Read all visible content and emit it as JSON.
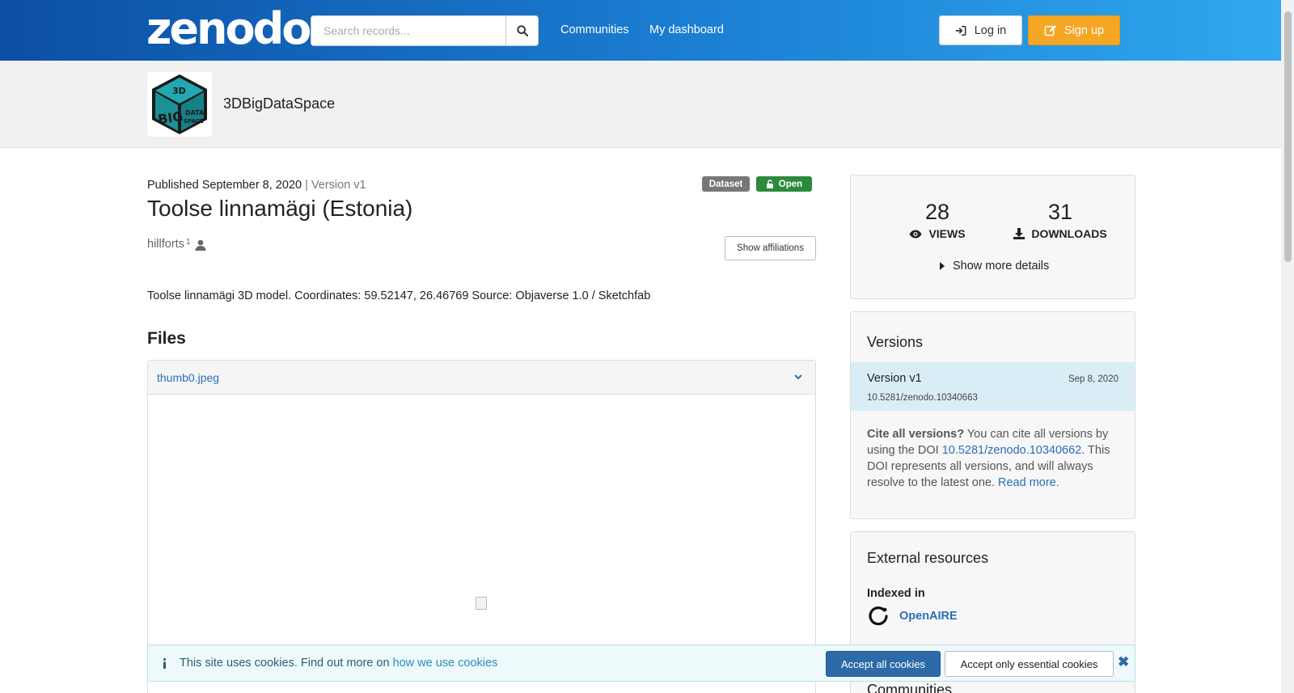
{
  "header": {
    "logo_text": "zenodo",
    "search_placeholder": "Search records...",
    "nav": [
      "Communities",
      "My dashboard"
    ],
    "login_label": "Log in",
    "signup_label": "Sign up"
  },
  "community": {
    "name": "3DBigDataSpace",
    "logo_text_big": "BIG",
    "logo_text_3d": "3D",
    "logo_text_data": "DATA",
    "logo_text_space": "SPACE"
  },
  "record": {
    "published": "Published September 8, 2020",
    "version_sep": " | ",
    "version": "Version v1",
    "badge_type": "Dataset",
    "badge_access": "Open",
    "title": "Toolse linnamägi (Estonia)",
    "creator": "hillforts",
    "creator_sup": "1",
    "affiliations_button": "Show affiliations",
    "description": "Toolse linnamägi 3D model. Coordinates: 59.52147, 26.46769 Source: Objaverse 1.0 / Sketchfab"
  },
  "files": {
    "heading": "Files",
    "filename": "thumb0.jpeg"
  },
  "stats": {
    "views": "28",
    "views_label": "VIEWS",
    "downloads": "31",
    "downloads_label": "DOWNLOADS",
    "more_label": "Show more details"
  },
  "versions": {
    "heading": "Versions",
    "current_name": "Version v1",
    "current_date": "Sep 8, 2020",
    "current_doi": "10.5281/zenodo.10340663",
    "cite_bold": "Cite all versions?",
    "cite_text1": " You can cite all versions by using the DOI ",
    "cite_doi": "10.5281/zenodo.10340662",
    "cite_text2": ". This DOI represents all versions, and will always resolve to the latest one. ",
    "read_more": "Read more."
  },
  "external": {
    "heading": "External resources",
    "indexed_in": "Indexed in",
    "openaire": "OpenAIRE",
    "communities_heading": "Communities"
  },
  "cookie": {
    "message": "This site uses cookies. Find out more on ",
    "link": "how we use cookies",
    "accept_all": "Accept all cookies",
    "accept_essential": "Accept only essential cookies",
    "close": "✖"
  },
  "colors": {
    "header_start": "#0c4fa4",
    "header_end": "#2fa8ef",
    "signup": "#f5a623",
    "open_badge": "#2b8a3e",
    "link": "#2a6ebb"
  }
}
